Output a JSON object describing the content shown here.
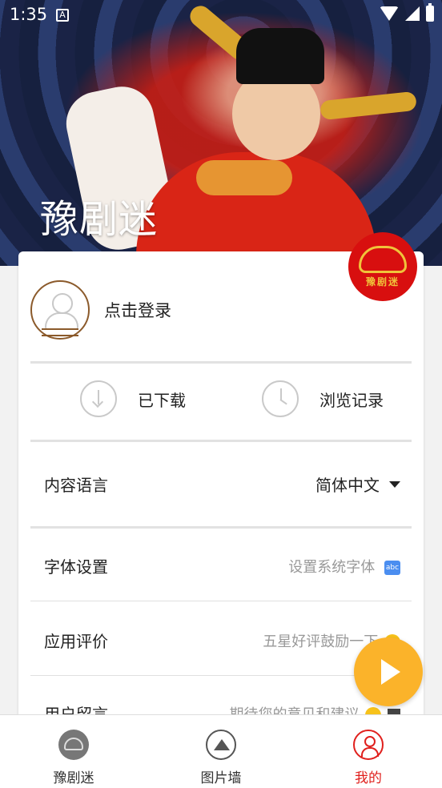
{
  "status": {
    "time": "1:35",
    "badge": "A"
  },
  "hero": {
    "title": "豫剧迷"
  },
  "logo_badge": {
    "text": "豫剧迷"
  },
  "login": {
    "label": "点击登录"
  },
  "quick": {
    "downloaded": "已下载",
    "history": "浏览记录"
  },
  "settings": {
    "language": {
      "label": "内容语言",
      "value": "简体中文"
    },
    "font": {
      "label": "字体设置",
      "value": "设置系统字体"
    },
    "rating": {
      "label": "应用评价",
      "value": "五星好评鼓励一下"
    },
    "feedback": {
      "label": "用户留言",
      "value": "期待您的意见和建议"
    }
  },
  "nav": {
    "items": [
      {
        "label": "豫剧迷",
        "icon": "opera-logo-icon",
        "active": false
      },
      {
        "label": "图片墙",
        "icon": "image-icon",
        "active": false
      },
      {
        "label": "我的",
        "icon": "user-icon",
        "active": true
      }
    ]
  },
  "colors": {
    "accent": "#e0201d",
    "fab": "#fbb32a",
    "badge": "#d80f0f"
  }
}
